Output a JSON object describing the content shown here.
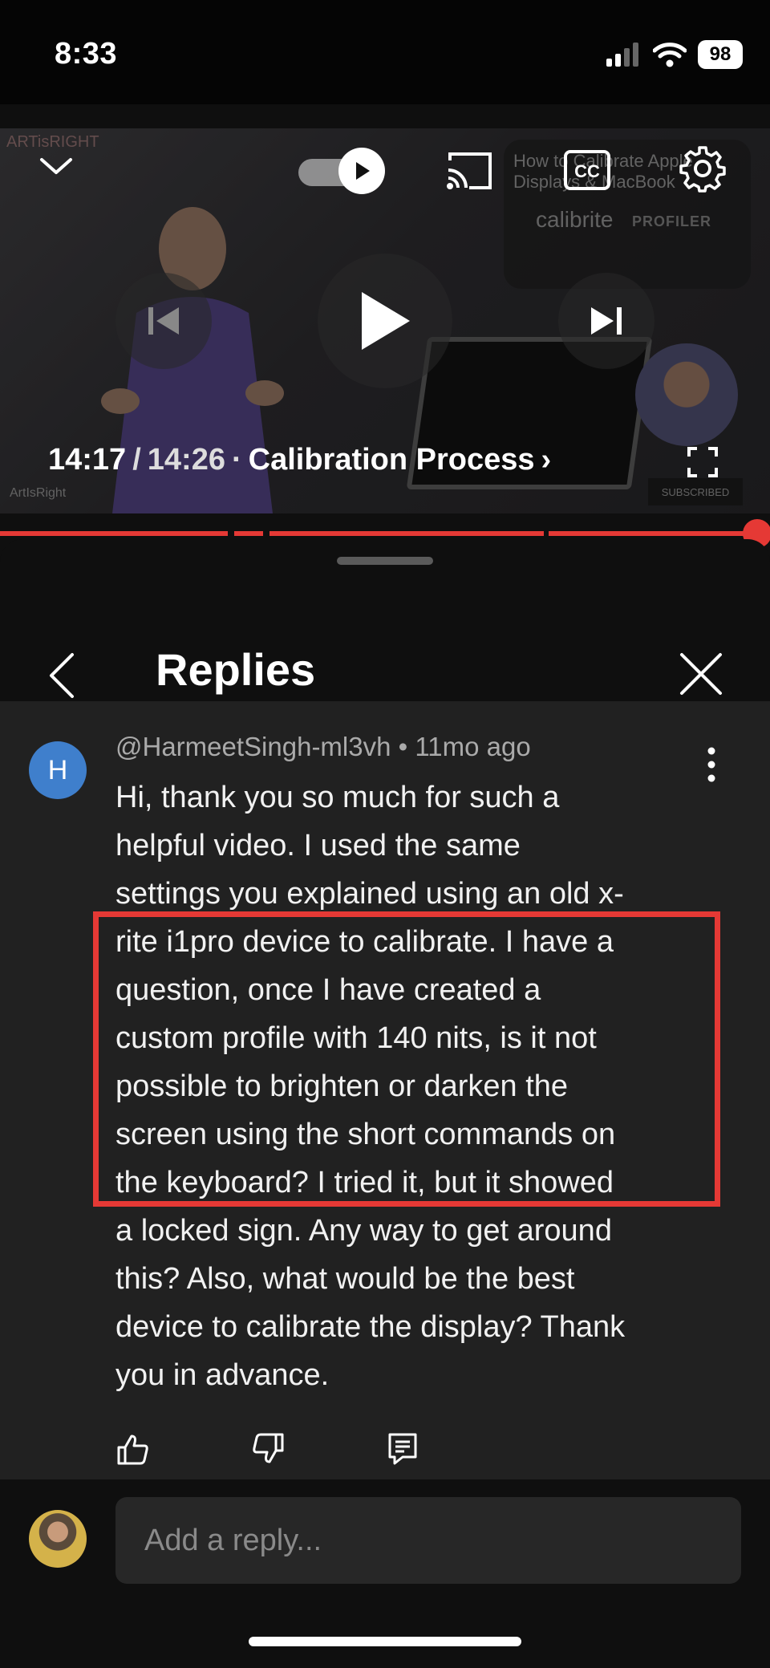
{
  "status": {
    "time": "8:33",
    "battery": "98"
  },
  "player": {
    "current_time": "14:17",
    "separator": "/",
    "duration": "14:26",
    "dot": "·",
    "chapter": "Calibration Process",
    "chapter_chevron": "›",
    "thumb_title": "How to Calibrate Apple Displays & MacBook",
    "thumb_sub": "calibrite",
    "thumb_brand": "PROFILER",
    "brand_top_left": "ARTisRIGHT",
    "brand_bottom_left": "ArtIsRight",
    "subscribed": "SUBSCRIBED",
    "progress_fraction": 0.99,
    "accent_color": "#e53935"
  },
  "sheet": {
    "title": "Replies"
  },
  "comment": {
    "avatar_letter": "H",
    "author": "@HarmeetSingh-ml3vh",
    "bullet": "•",
    "age": "11mo ago",
    "lines": [
      "Hi, thank you so much for such a",
      "helpful video. I used the same",
      "settings you explained using an old x-",
      "rite i1pro device to calibrate. I have a",
      "question, once I have created a",
      "custom profile with 140 nits, is it not",
      "possible to brighten or darken the",
      "screen using the short commands on",
      "the keyboard? I tried it, but it showed",
      "a locked sign. Any way to get around",
      "this? Also, what would be the best",
      "device to calibrate the display? Thank",
      "you in advance."
    ]
  },
  "reply": {
    "placeholder": "Add a reply..."
  },
  "icons": {
    "collapse": "chevron-down-icon",
    "autoplay": "autoplay-toggle-icon",
    "cast": "cast-icon",
    "captions": "captions-icon",
    "settings": "gear-icon",
    "previous": "skip-previous-icon",
    "play": "play-icon",
    "next": "skip-next-icon",
    "fullscreen": "fullscreen-icon",
    "back": "chevron-left-icon",
    "close": "close-icon",
    "more": "more-vertical-icon",
    "like": "thumbs-up-icon",
    "dislike": "thumbs-down-icon",
    "reply": "reply-icon"
  }
}
